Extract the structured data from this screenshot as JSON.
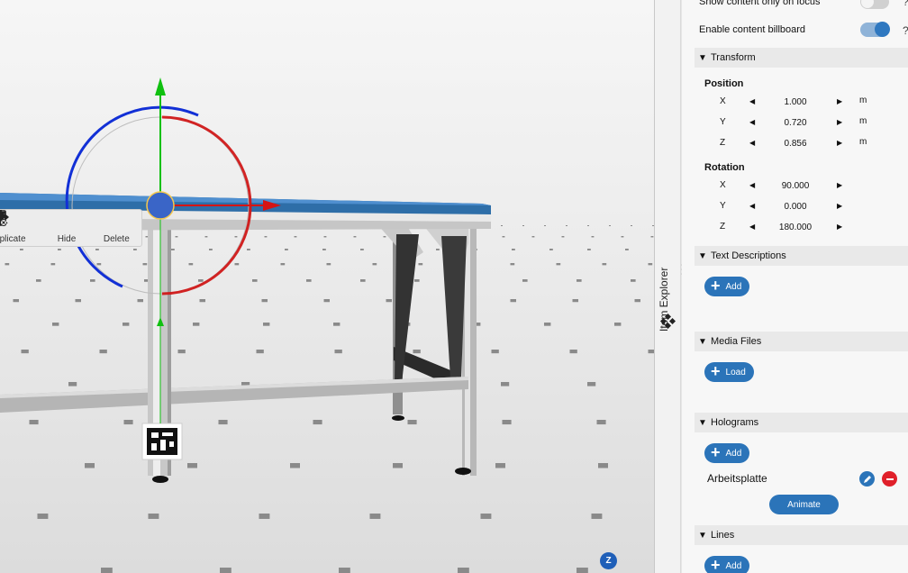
{
  "viewport": {
    "context_menu": [
      {
        "label": "Duplicate",
        "icon": "duplicate-icon"
      },
      {
        "label": "Hide",
        "icon": "eye-slash-icon"
      },
      {
        "label": "Delete",
        "icon": "trash-icon"
      }
    ],
    "axis_badge": "Z"
  },
  "side_tab": {
    "label": "Item Explorer",
    "icon": "diamond-cluster-icon"
  },
  "panel": {
    "toggles": [
      {
        "label": "Show content only on focus",
        "on": false
      },
      {
        "label": "Enable content billboard",
        "on": true
      }
    ],
    "help_icon": "?",
    "transform": {
      "title": "Transform",
      "position": {
        "title": "Position",
        "rows": [
          {
            "axis": "X",
            "value": "1.000",
            "unit": "m"
          },
          {
            "axis": "Y",
            "value": "0.720",
            "unit": "m"
          },
          {
            "axis": "Z",
            "value": "0.856",
            "unit": "m"
          }
        ]
      },
      "rotation": {
        "title": "Rotation",
        "rows": [
          {
            "axis": "X",
            "value": "90.000"
          },
          {
            "axis": "Y",
            "value": "0.000"
          },
          {
            "axis": "Z",
            "value": "180.000"
          }
        ]
      }
    },
    "sections": {
      "text_descriptions": {
        "title": "Text Descriptions",
        "button": "Add"
      },
      "media_files": {
        "title": "Media Files",
        "button": "Load"
      },
      "holograms": {
        "title": "Holograms",
        "button": "Add",
        "item": "Arbeitsplatte",
        "animate": "Animate"
      },
      "lines": {
        "title": "Lines",
        "button": "Add"
      }
    },
    "colors": {
      "accent": "#2b74b9",
      "delete": "#e0202a"
    }
  }
}
